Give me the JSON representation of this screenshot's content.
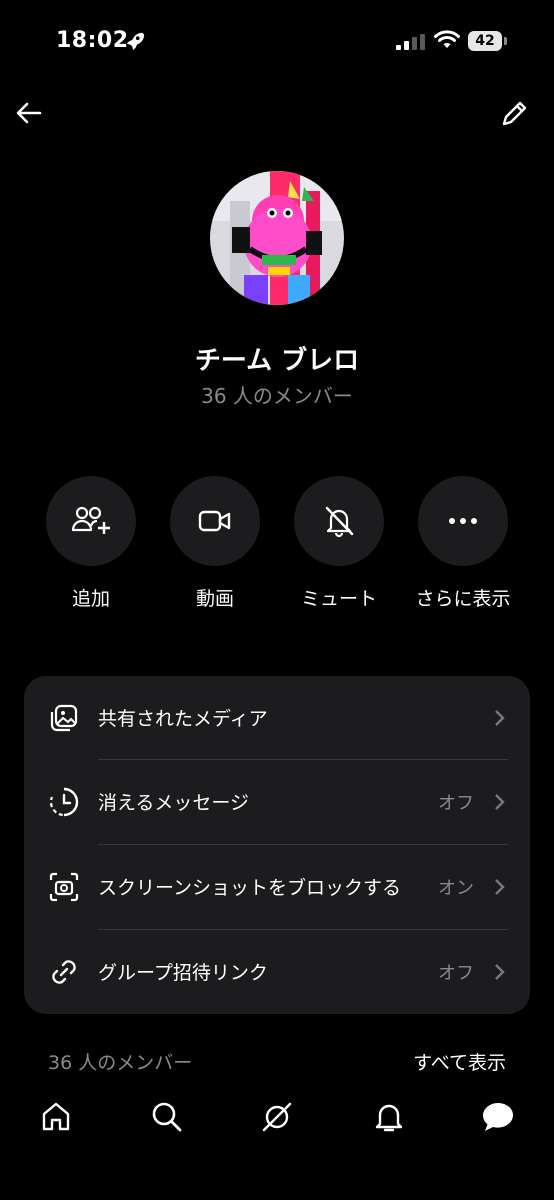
{
  "status_bar": {
    "time": "18:02",
    "battery": "42"
  },
  "group": {
    "name": "チーム ブレロ",
    "member_count_label": "36 人のメンバー"
  },
  "actions": [
    {
      "label": "追加",
      "icon": "add-people-icon"
    },
    {
      "label": "動画",
      "icon": "video-camera-icon"
    },
    {
      "label": "ミュート",
      "icon": "bell-muted-icon"
    },
    {
      "label": "さらに表示",
      "icon": "more-dots-icon"
    }
  ],
  "settings": [
    {
      "label": "共有されたメディア",
      "value": "",
      "icon": "media-photos-icon"
    },
    {
      "label": "消えるメッセージ",
      "value": "オフ",
      "icon": "timer-icon"
    },
    {
      "label": "スクリーンショットをブロックする",
      "value": "オン",
      "icon": "screenshot-camera-icon"
    },
    {
      "label": "グループ招待リンク",
      "value": "オフ",
      "icon": "link-icon"
    }
  ],
  "members_section": {
    "heading": "36 人のメンバー",
    "see_all": "すべて表示"
  },
  "tabs": [
    "home-icon",
    "search-icon",
    "grok-icon",
    "notifications-bell-icon",
    "messages-icon"
  ],
  "colors": {
    "background": "#000000",
    "card": "#1c1c1e",
    "secondary_text": "#8a8a8e"
  }
}
